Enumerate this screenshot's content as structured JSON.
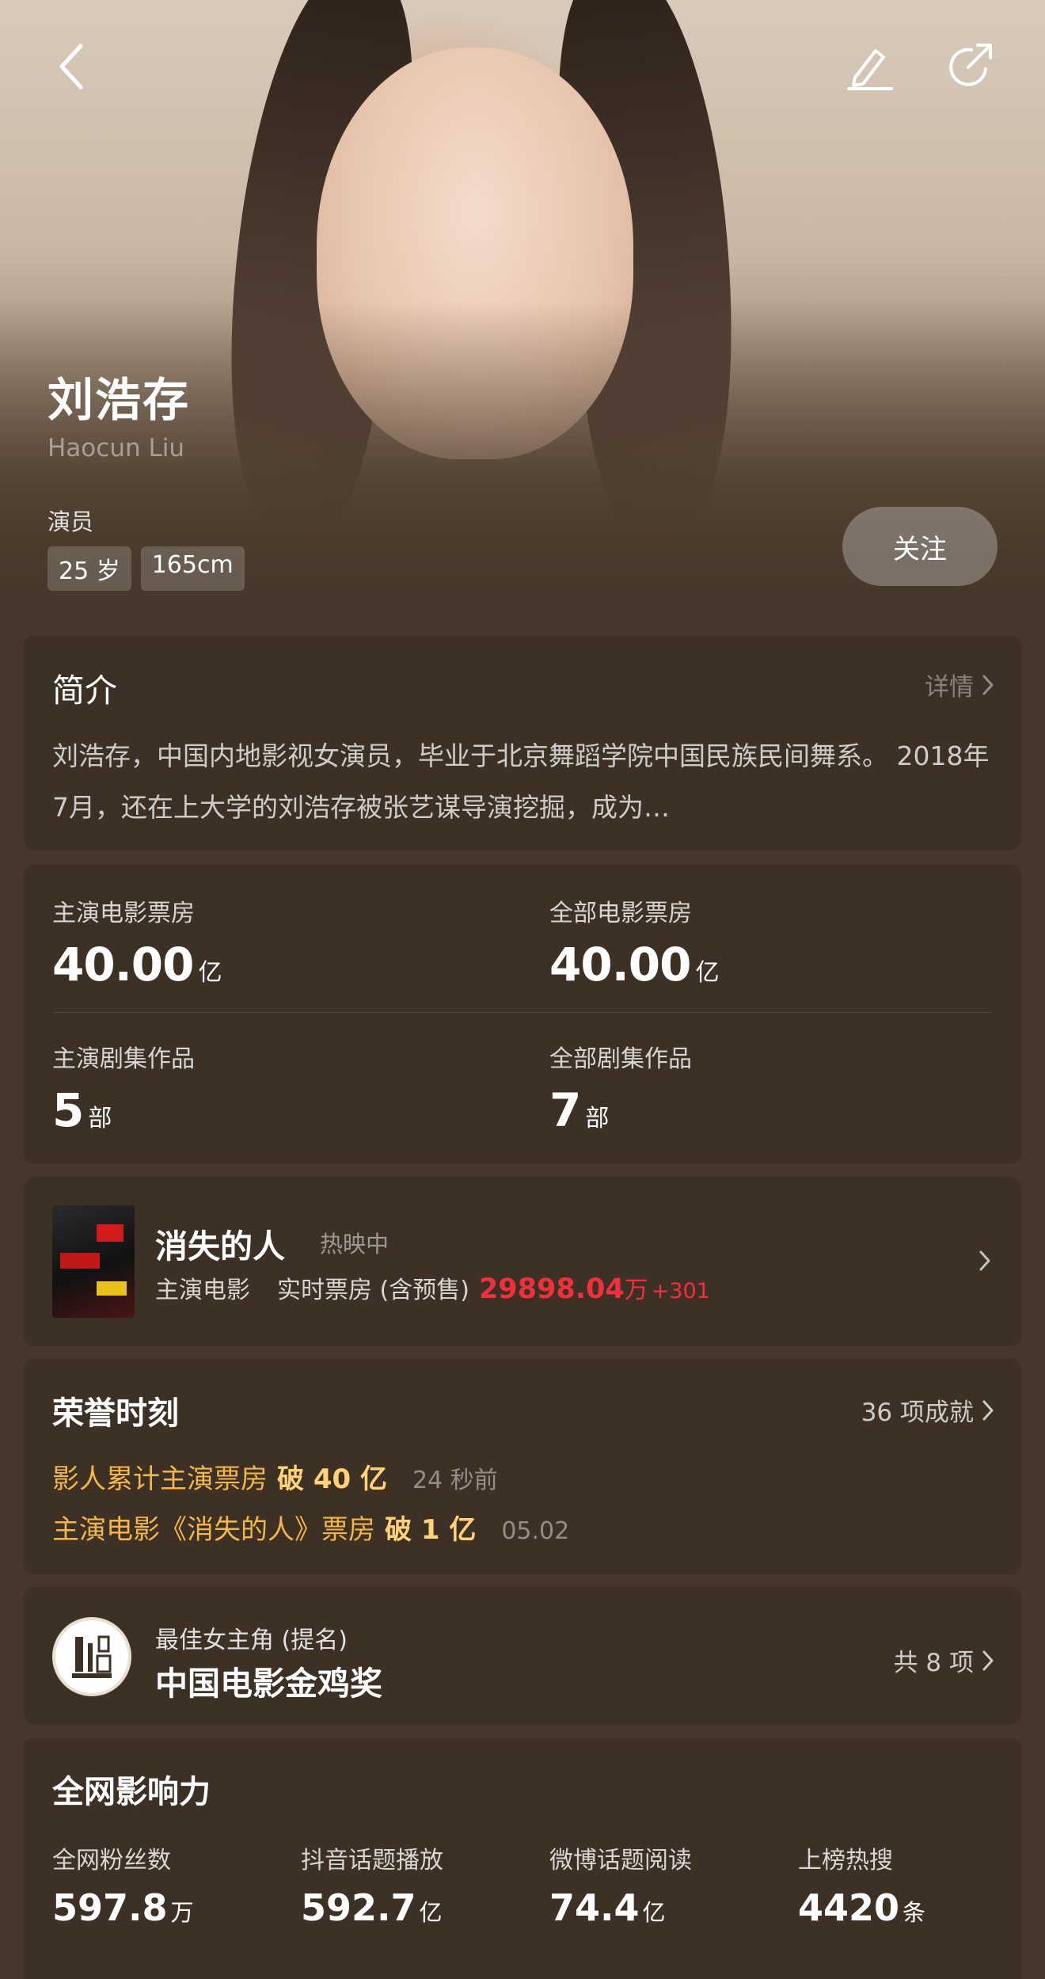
{
  "header": {
    "back_icon": "chevron-left-icon",
    "edit_icon": "pencil-icon",
    "share_icon": "share-icon"
  },
  "actor": {
    "name": "刘浩存",
    "name_en": "Haocun Liu",
    "role": "演员",
    "age": "25 岁",
    "height": "165cm",
    "follow_label": "关注"
  },
  "intro": {
    "title": "简介",
    "more_label": "详情",
    "text": "刘浩存，中国内地影视女演员，毕业于北京舞蹈学院中国民族民间舞系。 2018年7月，还在上大学的刘浩存被张艺谋导演挖掘，成为…"
  },
  "stats": [
    {
      "label": "主演电影票房",
      "value": "40.00",
      "unit": "亿"
    },
    {
      "label": "全部电影票房",
      "value": "40.00",
      "unit": "亿"
    },
    {
      "label": "主演剧集作品",
      "value": "5",
      "unit": "部"
    },
    {
      "label": "全部剧集作品",
      "value": "7",
      "unit": "部"
    }
  ],
  "movie": {
    "title": "消失的人",
    "status": "热映中",
    "type": "主演电影",
    "box_label": "实时票房 (含预售)",
    "box_value": "29898.04",
    "box_unit": "万",
    "box_increase": "+301"
  },
  "honor": {
    "title": "荣誉时刻",
    "more_label": "36 项成就",
    "items": [
      {
        "text": "影人累计主演票房",
        "highlight": "破 40 亿",
        "time": "24 秒前"
      },
      {
        "text": "主演电影《消失的人》票房",
        "highlight": "破 1 亿",
        "time": "05.02"
      }
    ]
  },
  "award": {
    "category": "最佳女主角 (提名)",
    "name": "中国电影金鸡奖",
    "more_label": "共 8 项"
  },
  "influence": {
    "title": "全网影响力",
    "items": [
      {
        "label": "全网粉丝数",
        "value": "597.8",
        "unit": "万"
      },
      {
        "label": "抖音话题播放",
        "value": "592.7",
        "unit": "亿"
      },
      {
        "label": "微博话题阅读",
        "value": "74.4",
        "unit": "亿"
      },
      {
        "label": "上榜热搜",
        "value": "4420",
        "unit": "条"
      }
    ]
  },
  "colors": {
    "background": "#453729",
    "card": "#3d3024",
    "accent_red": "#f0313d",
    "honor_gold": "#f2b64a"
  }
}
